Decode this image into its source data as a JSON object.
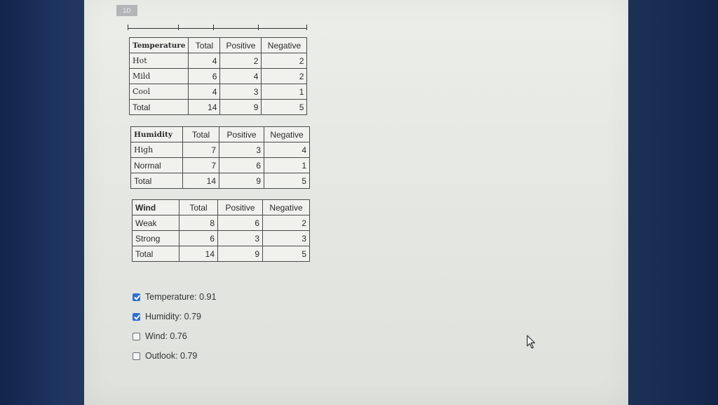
{
  "top_badge": "1D",
  "tables": [
    {
      "header": [
        "Temperature",
        "Total",
        "Positive",
        "Negative"
      ],
      "rows": [
        [
          "Hot",
          "4",
          "2",
          "2"
        ],
        [
          "Mild",
          "6",
          "4",
          "2"
        ],
        [
          "Cool",
          "4",
          "3",
          "1"
        ],
        [
          "Total",
          "14",
          "9",
          "5"
        ]
      ]
    },
    {
      "header": [
        "Humidity",
        "Total",
        "Positive",
        "Negative"
      ],
      "rows": [
        [
          "High",
          "7",
          "3",
          "4"
        ],
        [
          "Normal",
          "7",
          "6",
          "1"
        ],
        [
          "Total",
          "14",
          "9",
          "5"
        ]
      ]
    },
    {
      "header": [
        "Wind",
        "Total",
        "Positive",
        "Negative"
      ],
      "rows": [
        [
          "Weak",
          "8",
          "6",
          "2"
        ],
        [
          "Strong",
          "6",
          "3",
          "3"
        ],
        [
          "Total",
          "14",
          "9",
          "5"
        ]
      ]
    }
  ],
  "options": [
    {
      "label": "Temperature: 0.91",
      "checked": true
    },
    {
      "label": "Humidity: 0.79",
      "checked": true
    },
    {
      "label": "Wind: 0.76",
      "checked": false
    },
    {
      "label": "Outlook: 0.79",
      "checked": false
    }
  ],
  "icons": {
    "cursor": "mouse-pointer-icon",
    "checkbox_checked": "checkmark-icon"
  },
  "colors": {
    "checkbox_checked": "#2c6fd6",
    "page_background": "#e8eae6",
    "bezel": "#1d3360"
  }
}
